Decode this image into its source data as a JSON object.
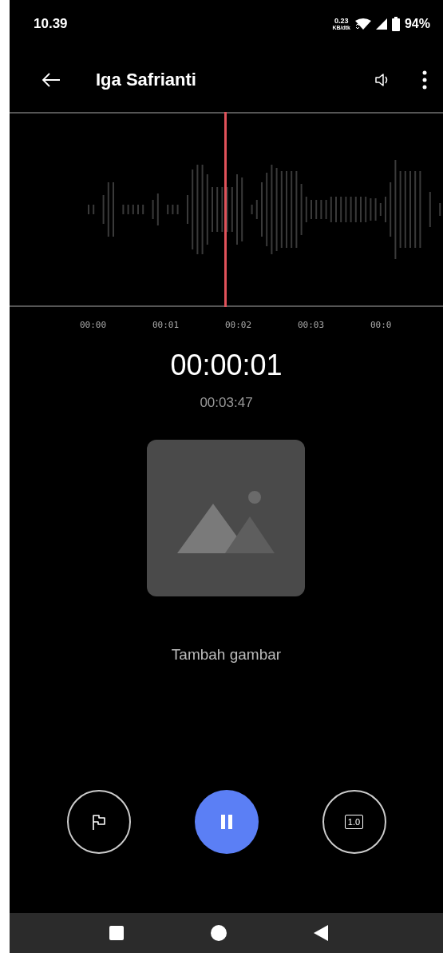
{
  "status_bar": {
    "time": "10.39",
    "data_rate": "0.23",
    "data_unit": "KB/dtk",
    "battery": "94%"
  },
  "header": {
    "title": "Iga Safrianti"
  },
  "timeline": {
    "ticks": [
      "00:00",
      "00:01",
      "00:02",
      "00:03",
      "00:0"
    ]
  },
  "elapsed": "00:00:01",
  "duration": "00:03:47",
  "add_image": {
    "label": "Tambah gambar"
  },
  "controls": {
    "speed": "1.0",
    "playing": true
  }
}
